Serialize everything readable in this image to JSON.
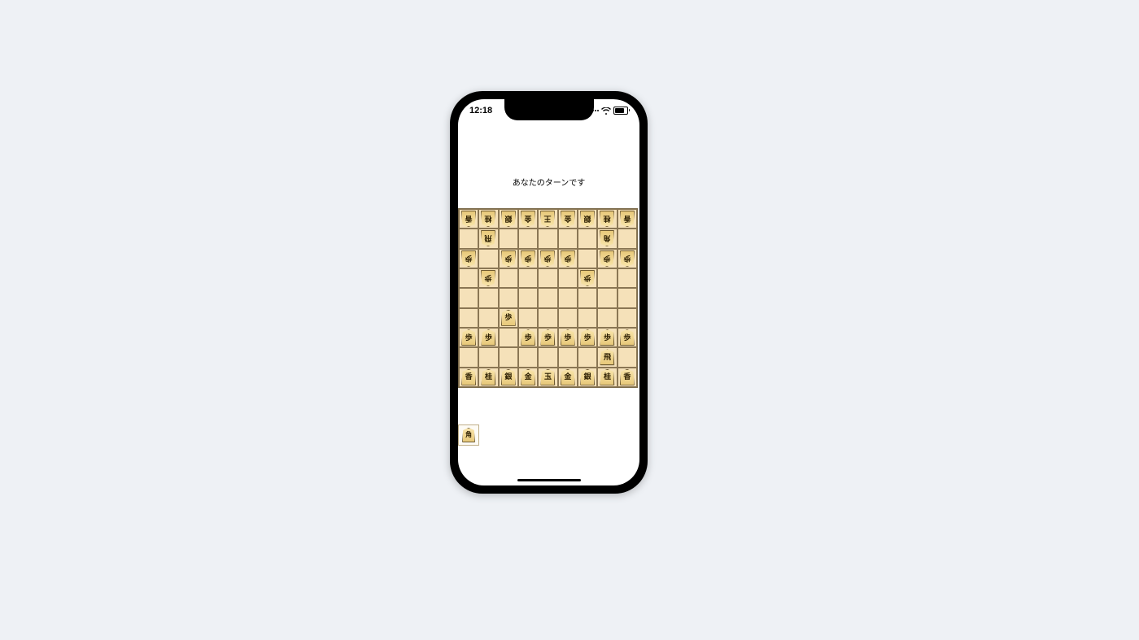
{
  "status_bar": {
    "time": "12:18"
  },
  "turn_message": "あなたのターンです",
  "board_size": 9,
  "board": [
    [
      {
        "p": "香",
        "o": true
      },
      {
        "p": "桂",
        "o": true
      },
      {
        "p": "銀",
        "o": true
      },
      {
        "p": "金",
        "o": true
      },
      {
        "p": "王",
        "o": true
      },
      {
        "p": "金",
        "o": true
      },
      {
        "p": "銀",
        "o": true
      },
      {
        "p": "桂",
        "o": true
      },
      {
        "p": "香",
        "o": true
      }
    ],
    [
      null,
      {
        "p": "飛",
        "o": true
      },
      null,
      null,
      null,
      null,
      null,
      {
        "p": "角",
        "o": true
      },
      null
    ],
    [
      {
        "p": "歩",
        "o": true
      },
      null,
      {
        "p": "歩",
        "o": true
      },
      {
        "p": "歩",
        "o": true
      },
      {
        "p": "歩",
        "o": true
      },
      {
        "p": "歩",
        "o": true
      },
      null,
      {
        "p": "歩",
        "o": true
      },
      {
        "p": "歩",
        "o": true
      }
    ],
    [
      null,
      {
        "p": "歩",
        "o": true
      },
      null,
      null,
      null,
      null,
      {
        "p": "歩",
        "o": true
      },
      null,
      null
    ],
    [
      null,
      null,
      null,
      null,
      null,
      null,
      null,
      null,
      null
    ],
    [
      null,
      null,
      {
        "p": "歩",
        "o": false
      },
      null,
      null,
      null,
      null,
      null,
      null
    ],
    [
      {
        "p": "歩",
        "o": false
      },
      {
        "p": "歩",
        "o": false
      },
      null,
      {
        "p": "歩",
        "o": false
      },
      {
        "p": "歩",
        "o": false
      },
      {
        "p": "歩",
        "o": false
      },
      {
        "p": "歩",
        "o": false
      },
      {
        "p": "歩",
        "o": false
      },
      {
        "p": "歩",
        "o": false
      }
    ],
    [
      null,
      null,
      null,
      null,
      null,
      null,
      null,
      {
        "p": "飛",
        "o": false
      },
      null
    ],
    [
      {
        "p": "香",
        "o": false
      },
      {
        "p": "桂",
        "o": false
      },
      {
        "p": "銀",
        "o": false
      },
      {
        "p": "金",
        "o": false
      },
      {
        "p": "玉",
        "o": false
      },
      {
        "p": "金",
        "o": false
      },
      {
        "p": "銀",
        "o": false
      },
      {
        "p": "桂",
        "o": false
      },
      {
        "p": "香",
        "o": false
      }
    ]
  ],
  "player_hand": [
    {
      "p": "角"
    }
  ],
  "opponent_hand": []
}
